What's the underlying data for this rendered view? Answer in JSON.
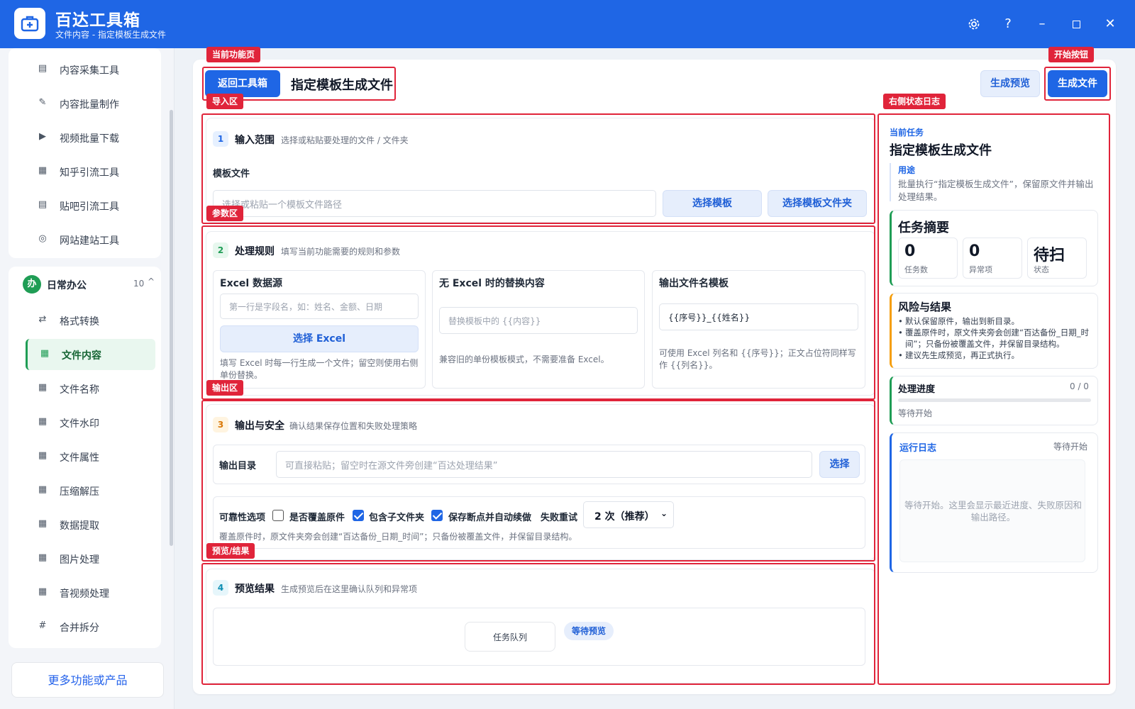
{
  "app": {
    "title": "百达工具箱",
    "subtitle": "文件内容 - 指定模板生成文件",
    "window_controls": [
      "settings-icon",
      "help-icon",
      "minimize-icon",
      "maximize-icon",
      "close-icon"
    ],
    "help_glyph": "?",
    "minimize_glyph": "–",
    "close_glyph": "✕"
  },
  "sidebar": {
    "top_items": [
      {
        "label": "内容采集工具",
        "icon": "doc-icon"
      },
      {
        "label": "内容批量制作",
        "icon": "pen-icon"
      },
      {
        "label": "视频批量下载",
        "icon": "video-icon"
      },
      {
        "label": "知乎引流工具",
        "icon": "book-icon"
      },
      {
        "label": "贴吧引流工具",
        "icon": "note-icon"
      },
      {
        "label": "网站建站工具",
        "icon": "globe-icon"
      }
    ],
    "group": {
      "badge": "办",
      "title": "日常办公",
      "count": "10",
      "caret": "^"
    },
    "group_items": [
      {
        "label": "格式转换",
        "icon": "swap-icon"
      },
      {
        "label": "文件内容",
        "icon": "grid-icon",
        "active": true
      },
      {
        "label": "文件名称",
        "icon": "grid-icon"
      },
      {
        "label": "文件水印",
        "icon": "grid-icon"
      },
      {
        "label": "文件属性",
        "icon": "grid-icon"
      },
      {
        "label": "压缩解压",
        "icon": "grid-icon"
      },
      {
        "label": "数据提取",
        "icon": "grid-icon"
      },
      {
        "label": "图片处理",
        "icon": "grid-icon"
      },
      {
        "label": "音视频处理",
        "icon": "grid-icon"
      },
      {
        "label": "合并拆分",
        "icon": "hash-icon"
      }
    ],
    "more_button": "更多功能或产品"
  },
  "header": {
    "back_button": "返回工具箱",
    "page_title": "指定模板生成文件",
    "preview_button": "生成预览",
    "generate_button": "生成文件"
  },
  "section1": {
    "step": "1",
    "title": "输入范围",
    "desc": "选择或粘贴要处理的文件 / 文件夹",
    "field_label": "模板文件",
    "placeholder": "选择或粘贴一个模板文件路径",
    "choose_template": "选择模板",
    "choose_folder": "选择模板文件夹"
  },
  "section2": {
    "step": "2",
    "title": "处理规则",
    "desc": "填写当前功能需要的规则和参数",
    "excel_card": {
      "title": "Excel 数据源",
      "placeholder": "第一行是字段名，如：姓名、金额、日期",
      "button": "选择 Excel",
      "note": "填写 Excel 时每一行生成一个文件；留空则使用右侧单份替换。"
    },
    "no_excel_card": {
      "title": "无 Excel 时的替换内容",
      "placeholder": "替换模板中的 {{内容}}",
      "note": "兼容旧的单份模板模式，不需要准备 Excel。"
    },
    "name_card": {
      "title": "输出文件名模板",
      "value": "{{序号}}_{{姓名}}",
      "note": "可使用 Excel 列名和 {{序号}}；正文占位符同样写作 {{列名}}。"
    }
  },
  "section3": {
    "step": "3",
    "title": "输出与安全",
    "desc": "确认结果保存位置和失败处理策略",
    "output_label": "输出目录",
    "output_placeholder": "可直接粘贴；留空时在源文件旁创建“百达处理结果”",
    "choose_button": "选择",
    "reliability_label": "可靠性选项",
    "overwrite_label": "是否覆盖原件",
    "overwrite_checked": false,
    "subfolder_label": "包含子文件夹",
    "subfolder_checked": true,
    "resume_label": "保存断点并自动续做",
    "resume_checked": true,
    "retry_label": "失败重试",
    "retry_value": "2 次（推荐）",
    "note": "覆盖原件时，原文件夹旁会创建“百达备份_日期_时间”；只备份被覆盖文件，并保留目录结构。"
  },
  "section4": {
    "step": "4",
    "title": "预览结果",
    "desc": "生成预览后在这里确认队列和异常项",
    "queue_label": "任务队列",
    "status_pill": "等待预览"
  },
  "right_panel": {
    "current_task_label": "当前任务",
    "current_task": "指定模板生成文件",
    "usage_label": "用途",
    "usage_text": "批量执行“指定模板生成文件”，保留原文件并输出处理结果。",
    "summary_title": "任务摘要",
    "stats": [
      {
        "value": "0",
        "label": "任务数"
      },
      {
        "value": "0",
        "label": "异常项"
      },
      {
        "value": "待扫",
        "label": "状态"
      }
    ],
    "risk_title": "风险与结果",
    "risk_items": [
      "默认保留原件，输出到新目录。",
      "覆盖原件时，原文件夹旁会创建“百达备份_日期_时间”；只备份被覆盖文件，并保留目录结构。",
      "建议先生成预览，再正式执行。"
    ],
    "progress_title": "处理进度",
    "progress_count": "0 / 0",
    "progress_value": 0,
    "progress_status": "等待开始",
    "log_title": "运行日志",
    "log_status": "等待开始",
    "log_placeholder": "等待开始。这里会显示最近进度、失败原因和输出路径。"
  },
  "annotations": {
    "current_page": "当前功能页",
    "start_button": "开始按钮",
    "import_area": "导入区",
    "right_log": "右侧状态日志",
    "param_area": "参数区",
    "output_area": "输出区",
    "preview_area": "预览/结果"
  },
  "colors": {
    "brand": "#1f66e5",
    "active_green": "#1f9d55",
    "annotation_red": "#e0243a"
  }
}
